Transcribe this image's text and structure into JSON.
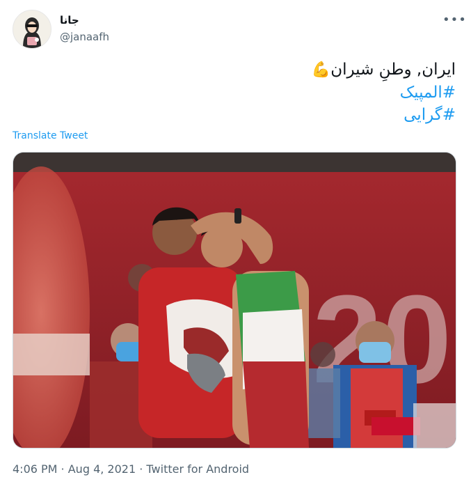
{
  "user": {
    "display_name": "جانا",
    "handle": "@janaafh",
    "avatar_icon": "avatar-illustration-icon"
  },
  "menu": {
    "more_label": "•••"
  },
  "tweet": {
    "line1": "ایران, وطنِ شیران",
    "emoji": "💪",
    "hashtag1": "#المپیک",
    "hashtag2": "#گرایی"
  },
  "translate_label": "Translate Tweet",
  "media": {
    "alt_icon": "photo-wrestlers-embrace-icon"
  },
  "meta": {
    "time": "4:06 PM",
    "sep1": " · ",
    "date": "Aug 4, 2021",
    "sep2": " · ",
    "source": "Twitter for Android"
  },
  "colors": {
    "link": "#1d9bf0",
    "muted": "#536471",
    "text": "#0f1419"
  }
}
